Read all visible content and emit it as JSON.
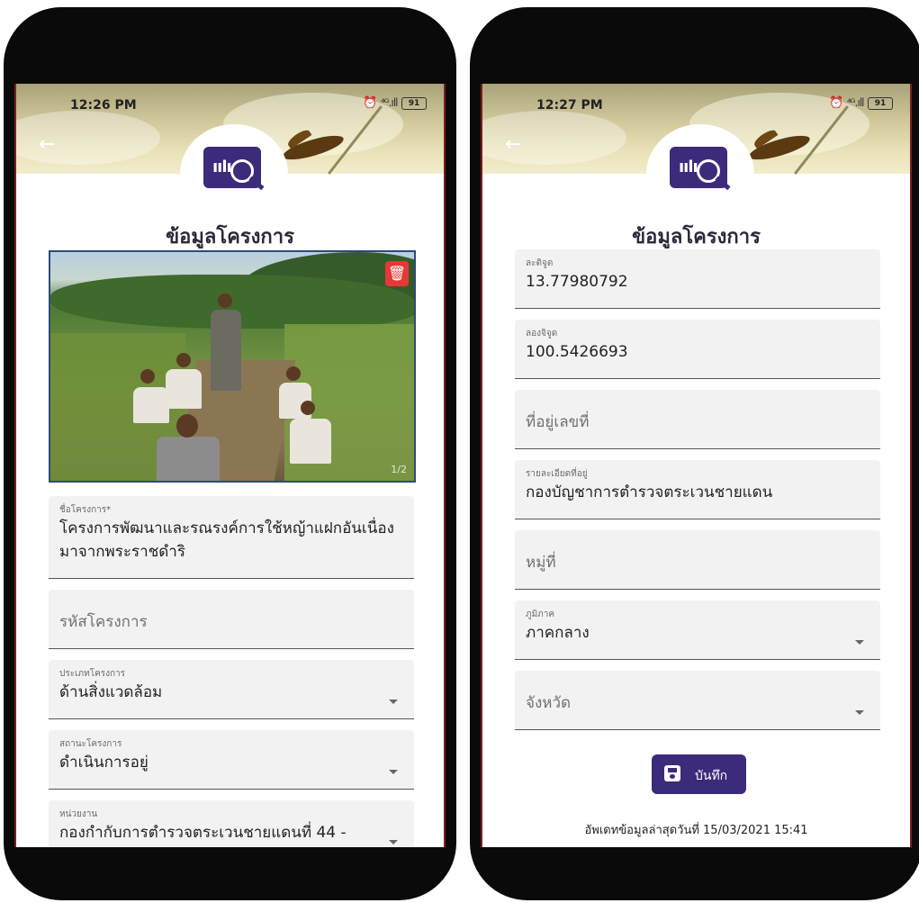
{
  "left_screen": {
    "status": {
      "time": "12:26 PM",
      "signal": "⁴ᴳ.ıll",
      "battery": "91"
    },
    "title": "ข้อมูลโครงการ",
    "photo": {
      "counter": "1/2"
    },
    "fields": {
      "project_name": {
        "label": "ชื่อโครงการ*",
        "value": " โครงการพัฒนาและรณรงค์การใช้หญ้าแฝกอันเนื่องมาจากพระราชดำริ"
      },
      "project_code": {
        "placeholder": "รหัสโครงการ"
      },
      "project_type": {
        "label": "ประเภทโครงการ",
        "value": "ด้านสิ่งแวดล้อม"
      },
      "project_status": {
        "label": "สถานะโครงการ",
        "value": "ดำเนินการอยู่"
      },
      "agency": {
        "label": "หน่วยงาน",
        "value": "กองกำกับการตำรวจตระเวนชายแดนที่ 44  -"
      }
    }
  },
  "right_screen": {
    "status": {
      "time": "12:27 PM",
      "signal": "⁴ᴳ.ıll",
      "battery": "91"
    },
    "title": "ข้อมูลโครงการ",
    "fields": {
      "latitude": {
        "label": "ละติจูด",
        "value": "13.77980792"
      },
      "longitude": {
        "label": "ลองจิจูด",
        "value": "100.5426693"
      },
      "address_no": {
        "placeholder": "ที่อยู่เลขที่"
      },
      "address_detail": {
        "label": "รายละเอียดที่อยู่",
        "value": "กองบัญชาการตำรวจตระเวนชายแดน"
      },
      "village_no": {
        "placeholder": "หมู่ที่"
      },
      "region": {
        "label": "ภูมิภาค",
        "value": "ภาคกลาง"
      },
      "province": {
        "placeholder": "จังหวัด"
      }
    },
    "save_label": "บันทึก",
    "updated_text": "อัพเดทข้อมูลล่าสุดวันที่ 15/03/2021  15:41"
  },
  "icons": [
    "back-arrow-icon",
    "alarm-icon",
    "signal-icon",
    "battery-icon",
    "app-logo-icon",
    "trash-icon",
    "save-disk-icon",
    "chevron-down-icon"
  ],
  "colors": {
    "brand": "#3c2a7b",
    "delete": "#e53935",
    "field_bg": "#f2f2f2"
  }
}
